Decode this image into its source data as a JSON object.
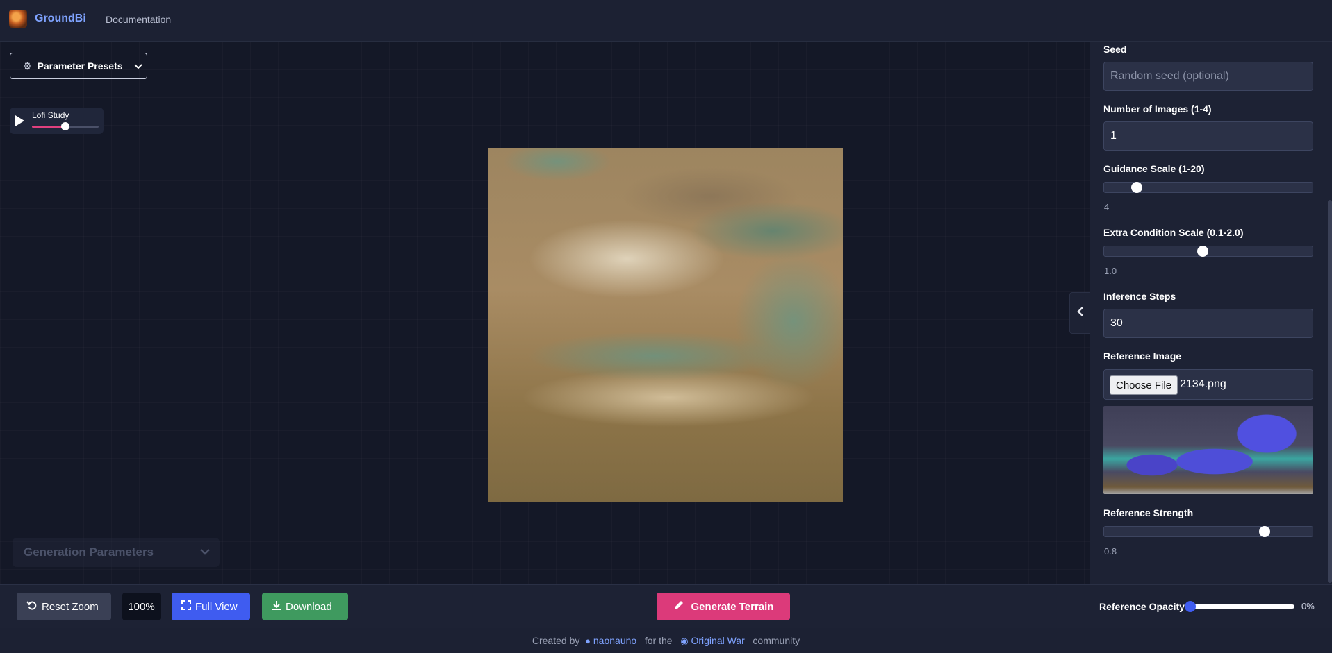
{
  "header": {
    "brand": "GroundBi",
    "nav_documentation": "Documentation"
  },
  "presets": {
    "label": "Parameter Presets"
  },
  "player": {
    "title": "Lofi Study",
    "volume_fraction": 0.5
  },
  "generation_params": {
    "label": "Generation Parameters"
  },
  "panel": {
    "seed": {
      "label": "Seed",
      "placeholder": "Random seed (optional)"
    },
    "num_images": {
      "label": "Number of Images (1-4)",
      "value": "1"
    },
    "guidance": {
      "label": "Guidance Scale (1-20)",
      "value": "4",
      "fraction": 0.158
    },
    "extra_condition": {
      "label": "Extra Condition Scale (0.1-2.0)",
      "value": "1.0",
      "fraction": 0.474
    },
    "inference_steps": {
      "label": "Inference Steps",
      "value": "30"
    },
    "reference_image": {
      "label": "Reference Image",
      "button": "Choose File",
      "filename": "2134.png"
    },
    "reference_strength": {
      "label": "Reference Strength",
      "value": "0.8",
      "fraction": 0.77
    }
  },
  "toolbar": {
    "reset_zoom": "Reset Zoom",
    "zoom_level": "100%",
    "full_view": "Full View",
    "download": "Download",
    "generate": "Generate Terrain",
    "opacity_label": "Reference Opacity",
    "opacity_value": "0%",
    "opacity_fraction": 0
  },
  "footer": {
    "created_by": "Created by",
    "author": "naonauno",
    "for_the": "for the",
    "community_name": "Original War",
    "community": "community"
  },
  "colors": {
    "accent_blue": "#3f5cf0",
    "accent_pink": "#dc3a7a",
    "accent_green": "#3f9a5f",
    "brand": "#7fa3ff"
  }
}
